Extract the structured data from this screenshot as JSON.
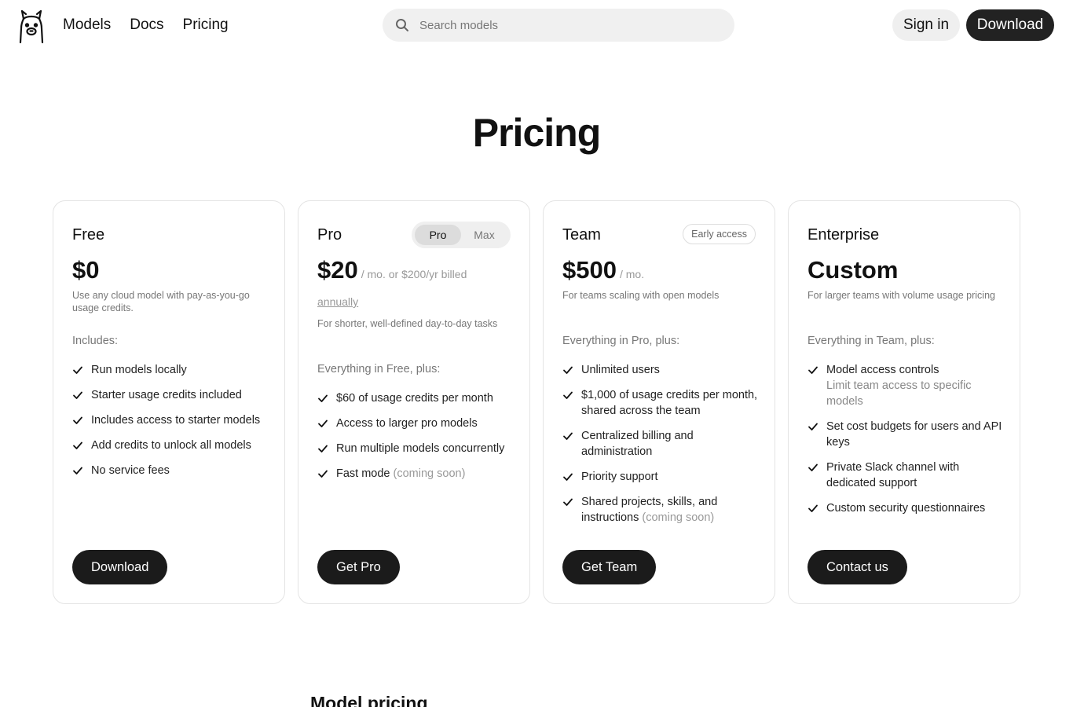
{
  "header": {
    "nav": [
      "Models",
      "Docs",
      "Pricing"
    ],
    "search_placeholder": "Search models",
    "signin_label": "Sign in",
    "download_label": "Download"
  },
  "page_title": "Pricing",
  "cards": [
    {
      "name": "Free",
      "price": "$0",
      "description": "Use any cloud model with pay-as-you-go usage credits.",
      "includes_label": "Includes:",
      "features": [
        "Run models locally",
        "Starter usage credits included",
        "Includes access to starter models",
        "Add credits to unlock all models",
        "No service fees"
      ],
      "cta": "Download"
    },
    {
      "name": "Pro",
      "toggle": {
        "options": [
          "Pro",
          "Max"
        ],
        "selected": "Pro"
      },
      "price": "$20",
      "price_note": "/ mo. or $200/yr billed",
      "price_link": "annually",
      "description": "For shorter, well-defined day-to-day tasks",
      "includes_label": "Everything in Free, plus:",
      "features": [
        "$60 of usage credits per month",
        "Access to larger pro models",
        "Run multiple models concurrently",
        "Fast mode"
      ],
      "feature_note": "(coming soon)",
      "cta": "Get Pro"
    },
    {
      "name": "Team",
      "badge": "Early access",
      "price": "$500",
      "price_note": "/ mo.",
      "description": "For teams scaling with open models",
      "includes_label": "Everything in Pro, plus:",
      "features": [
        "Unlimited users",
        "$1,000 of usage credits per month, shared across the team",
        "Centralized billing and administration",
        "Priority support",
        "Shared projects, skills, and instructions"
      ],
      "feature_note": "(coming soon)",
      "cta": "Get Team"
    },
    {
      "name": "Enterprise",
      "price": "Custom",
      "description": "For larger teams with volume usage pricing",
      "includes_label": "Everything in Team, plus:",
      "features": [
        "Model access controls",
        "Set cost budgets for users and API keys",
        "Private Slack channel with dedicated support",
        "Custom security questionnaires"
      ],
      "feature_sub": "Limit team access to specific models",
      "cta": "Contact us"
    }
  ],
  "section_title": "Model pricing",
  "icons": {
    "logo": "llama-logo-icon",
    "search": "search-icon",
    "check": "check-icon"
  },
  "colors": {
    "primary_button": "#1b1b1b",
    "muted_text": "#777777",
    "card_border": "#e4e4e4"
  }
}
